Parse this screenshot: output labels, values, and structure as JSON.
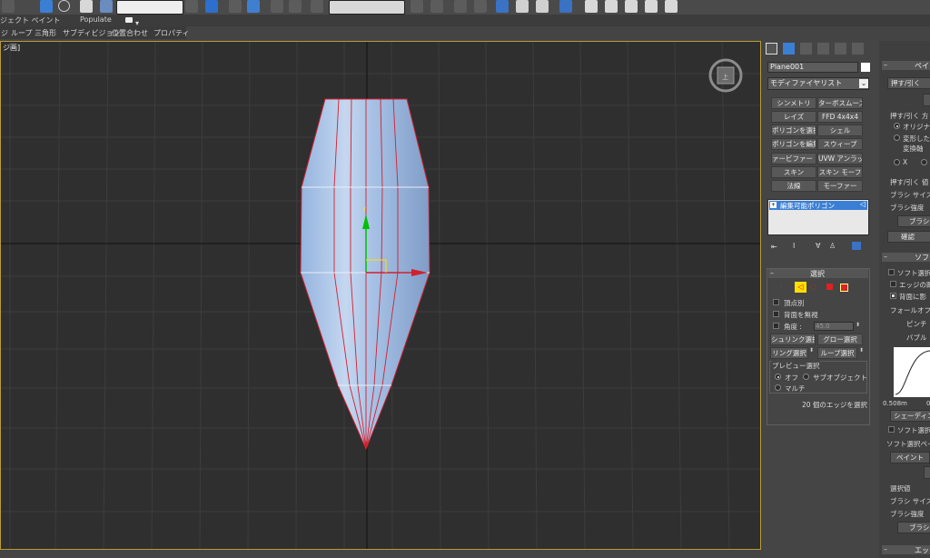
{
  "ribbon": {
    "paint_label": "ジェクト ペイント",
    "populate_label": "Populate"
  },
  "menubar": {
    "items": [
      "ジ",
      "ループ",
      "三角形",
      "サブディビジョン",
      "位置合わせ",
      "プロパティ"
    ]
  },
  "viewport": {
    "label": "ジ画]"
  },
  "command_panel": {
    "object_name": "Plane001",
    "modifier_list": "モディファイヤリスト",
    "modifier_buttons": [
      [
        "シンメトリ",
        "ターボスムーズ"
      ],
      [
        "レイズ",
        "FFD 4x4x4"
      ],
      [
        "ポリゴンを選択",
        "シェル"
      ],
      [
        "ポリゴンを編集",
        "スウィープ"
      ],
      [
        "ァービファー (WS",
        "UVW アンラップ"
      ],
      [
        "スキン",
        "スキン モーフ"
      ],
      [
        "法線",
        "モーファー"
      ]
    ],
    "stack_item": "編集可能ポリゴン",
    "selection": {
      "title": "選択",
      "by_vertex": "頂点別",
      "ignore_backfacing": "背面を無視",
      "angle_label": "角度 :",
      "angle_value": "45.0",
      "shrink": "シュリンク選択",
      "grow": "グロー選択",
      "ring": "リング選択",
      "loop": "ループ選択",
      "preview_title": "プレビュー選択",
      "preview_off": "オフ",
      "preview_subobject": "サブオブジェクト",
      "preview_multi": "マルチ",
      "status": "20 個のエッジを選択"
    }
  },
  "right_panel": {
    "paint_title": "ペイン",
    "push_pull": "押す/引く",
    "push_dir": "押す/引く 方",
    "original": "オリジナル",
    "deformed": "変形した",
    "transform_axis": "変換軸",
    "axis_x": "X",
    "push_value": "押す/引く 値",
    "brush_size": "ブラシ サイズ",
    "brush_strength": "ブラシ強度",
    "brush_options": "ブラシオ",
    "confirm": "確認",
    "soft_title": "ソフ",
    "soft_select": "ソフト選択",
    "edge_dist": "エッジの距",
    "affect_back": "背面に影",
    "falloff": "フォールオフ",
    "pinch": "ピンチ",
    "bubble": "バブル",
    "curve_min": "0.508m",
    "curve_max": "0",
    "shading": "シェーディン",
    "soft_lock": "ソフト選択",
    "soft_paint_title": "ソフト選択ペイ",
    "paint": "ペイント",
    "select_value": "選択値",
    "brush_size2": "ブラシ サイズ",
    "brush_strength2": "ブラシ強度",
    "brush_options2": "ブラシ",
    "edge_title": "エッジ"
  },
  "colors": {
    "mesh_fill": "#a8c2e6",
    "edge_selected": "#d2202e",
    "axis_y": "#00c000",
    "axis_x": "#d2202e",
    "active_border": "#b89c38"
  }
}
